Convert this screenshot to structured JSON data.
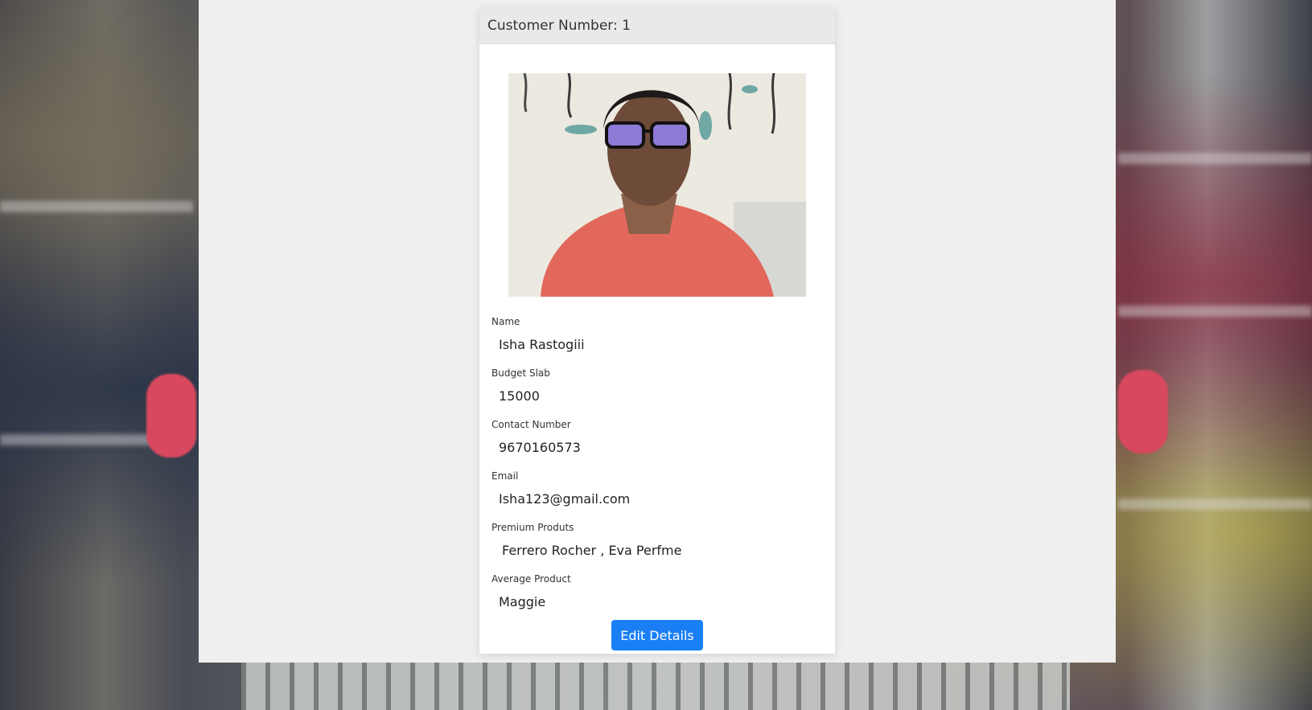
{
  "card": {
    "header": "Customer Number: 1"
  },
  "fields": [
    {
      "label": "Name",
      "value": "Isha Rastogiii"
    },
    {
      "label": "Budget Slab",
      "value": "15000"
    },
    {
      "label": "Contact Number",
      "value": "9670160573"
    },
    {
      "label": "Email",
      "value": "Isha123@gmail.com"
    },
    {
      "label": "Premium Produts",
      "value": "Ferrero Rocher , Eva Perfme"
    },
    {
      "label": "Average Product",
      "value": "Maggie"
    }
  ],
  "actions": {
    "edit_label": "Edit Details"
  },
  "colors": {
    "button": "#1a7ff5",
    "panel": "#efefef",
    "header": "#e9e9e9"
  }
}
